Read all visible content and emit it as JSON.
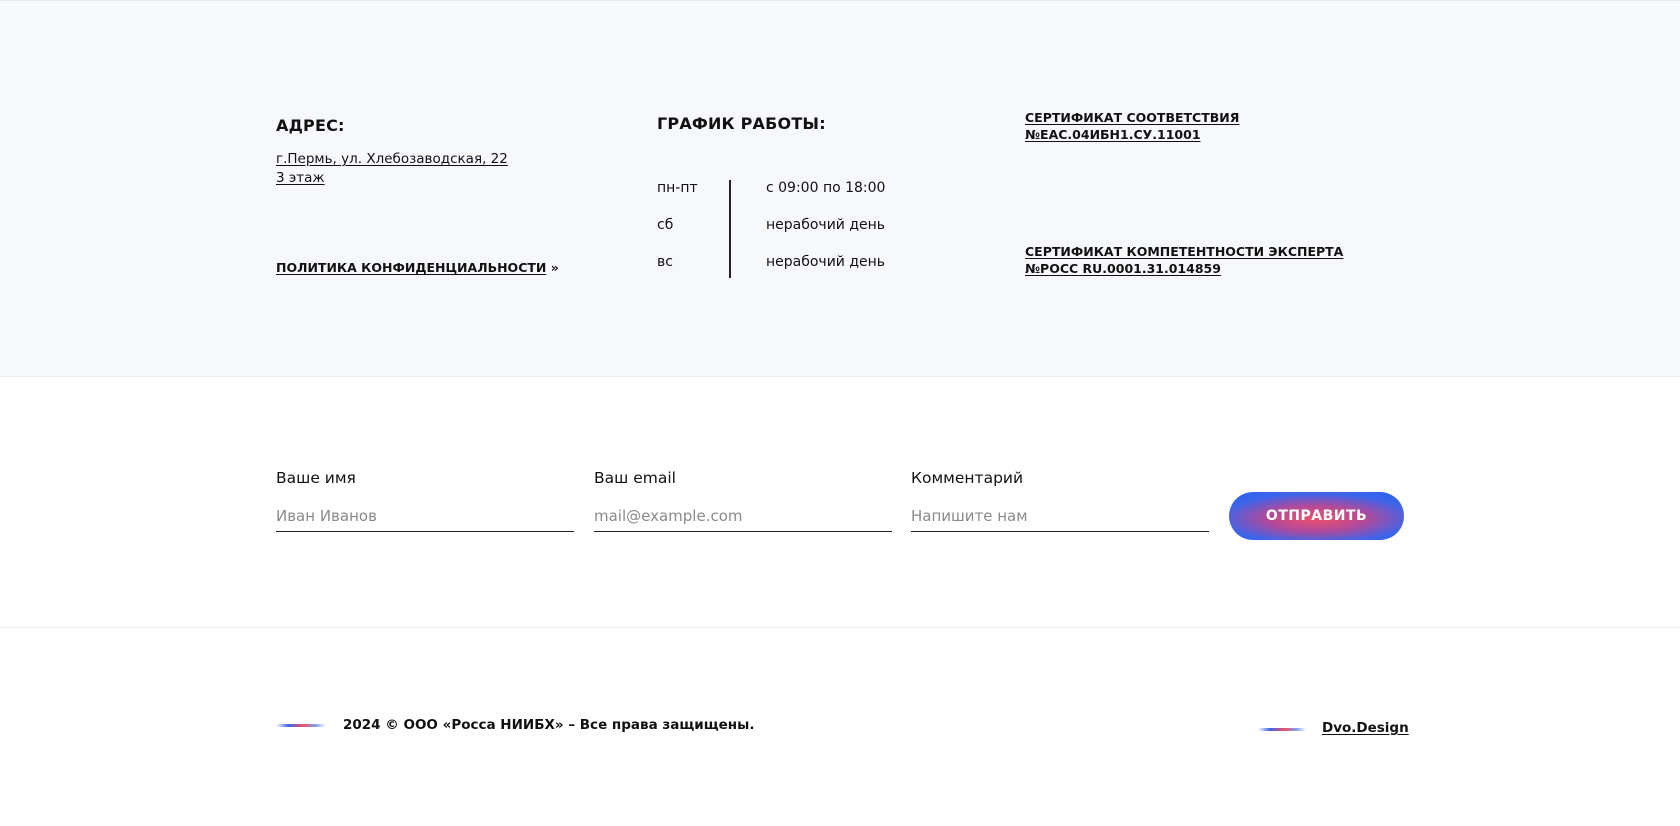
{
  "info": {
    "address": {
      "heading": "АДРЕС:",
      "line1": "г.Пермь, ул. Хлебозаводская, 22",
      "line2": "3 этаж"
    },
    "privacy": {
      "link": "ПОЛИТИКА КОНФИДЕНЦИАЛЬНОСТИ",
      "arrow": "»"
    },
    "schedule": {
      "heading": "ГРАФИК РАБОТЫ:",
      "rows": [
        {
          "day": "пн-пт",
          "time": "с 09:00 по 18:00"
        },
        {
          "day": "сб",
          "time": "нерабочий день"
        },
        {
          "day": "вс",
          "time": "нерабочий день"
        }
      ]
    },
    "certificates": [
      {
        "line1": "СЕРТИФИКАТ СООТВЕТСТВИЯ",
        "line2": "№ЕАС.04ИБН1.СУ.11001"
      },
      {
        "line1": "СЕРТИФИКАТ КОМПЕТЕНТНОСТИ ЭКСПЕРТА",
        "line2": "№РОСС RU.0001.31.014859"
      }
    ]
  },
  "form": {
    "name": {
      "label": "Ваше имя",
      "placeholder": "Иван Иванов"
    },
    "email": {
      "label": "Ваш email",
      "placeholder": "mail@example.com"
    },
    "comment": {
      "label": "Комментарий",
      "placeholder": "Напишите нам"
    },
    "submit_label": "ОТПРАВИТЬ"
  },
  "footer": {
    "copyright": "2024 © ООО «Росса НИИБХ» – Все права защищены.",
    "designer": "Dvo.Design"
  },
  "colors": {
    "accent_blue": "#2563eb",
    "accent_red": "#f0506a",
    "info_background": "#f7f8fc"
  }
}
